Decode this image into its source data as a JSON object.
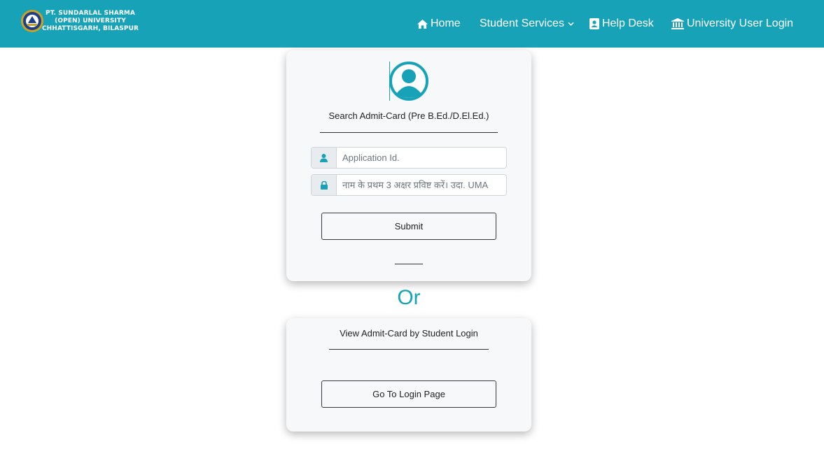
{
  "brand": {
    "line1": "PT. SUNDARLAL SHARMA",
    "line2": "(OPEN) UNIVERSITY",
    "line3": "CHHATTISGARH, BILASPUR"
  },
  "nav": {
    "home": "Home",
    "student_services": "Student Services",
    "help_desk": "Help Desk",
    "university_login": "University User Login"
  },
  "search_card": {
    "title": "Search Admit-Card (Pre B.Ed./D.El.Ed.)",
    "application_id_placeholder": "Application Id.",
    "name_placeholder": "नाम के प्रथम 3 अक्षर प्रविष्ट करें। उदा. UMA",
    "submit_label": "Submit"
  },
  "or_text": "Or",
  "login_card": {
    "title": "View Admit-Card by Student Login",
    "button_label": "Go To Login Page"
  },
  "colors": {
    "primary": "#17a2b8",
    "card_bg": "#f7f8fa"
  }
}
